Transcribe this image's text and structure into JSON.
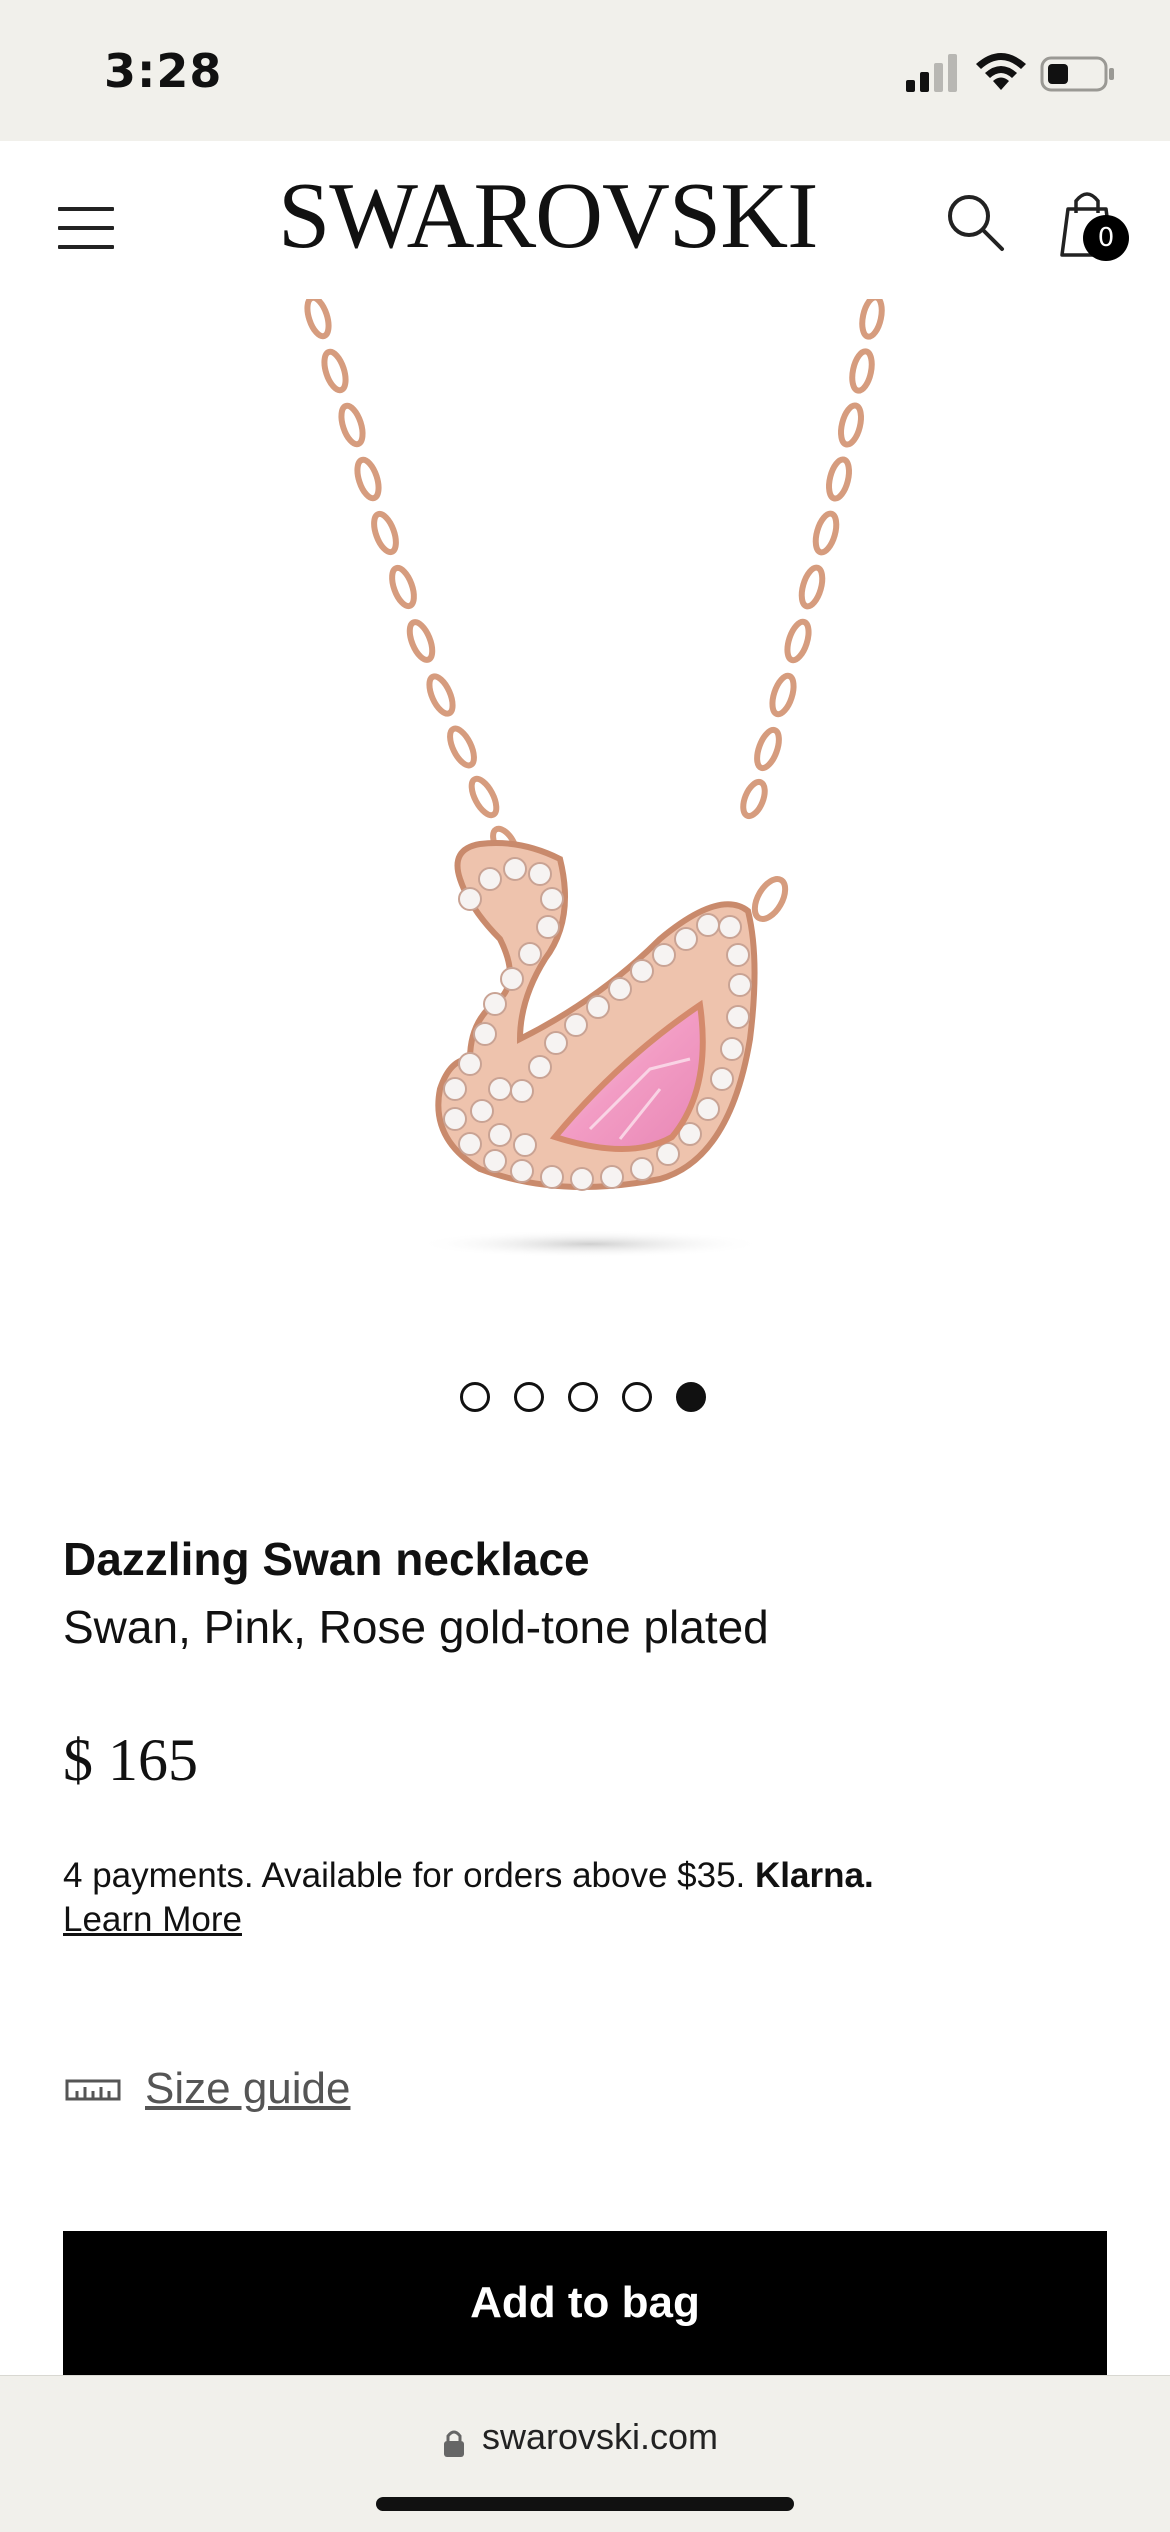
{
  "status_bar": {
    "time": "3:28",
    "icons": [
      "signal-icon",
      "wifi-icon",
      "battery-icon"
    ]
  },
  "header": {
    "brand": "SWAROVSKI",
    "bag_count": "0",
    "icons": [
      "menu-icon",
      "search-icon",
      "shopping-bag-icon"
    ]
  },
  "carousel": {
    "total": 5,
    "active_index": 4
  },
  "product": {
    "name": "Dazzling Swan necklace",
    "description": "Swan, Pink, Rose gold-tone plated",
    "price": "$ 165",
    "klarna_text": "4 payments. Available for orders above $35. ",
    "klarna_brand": "Klarna.",
    "learn_more": "Learn More",
    "size_guide": "Size guide"
  },
  "actions": {
    "add_to_bag": "Add to bag"
  },
  "browser": {
    "url": "swarovski.com"
  },
  "colors": {
    "chrome_bg": "#f1f0eb",
    "rose_gold": "#d9a184",
    "pink_crystal": "#f2a3c8",
    "button_bg": "#000000"
  }
}
